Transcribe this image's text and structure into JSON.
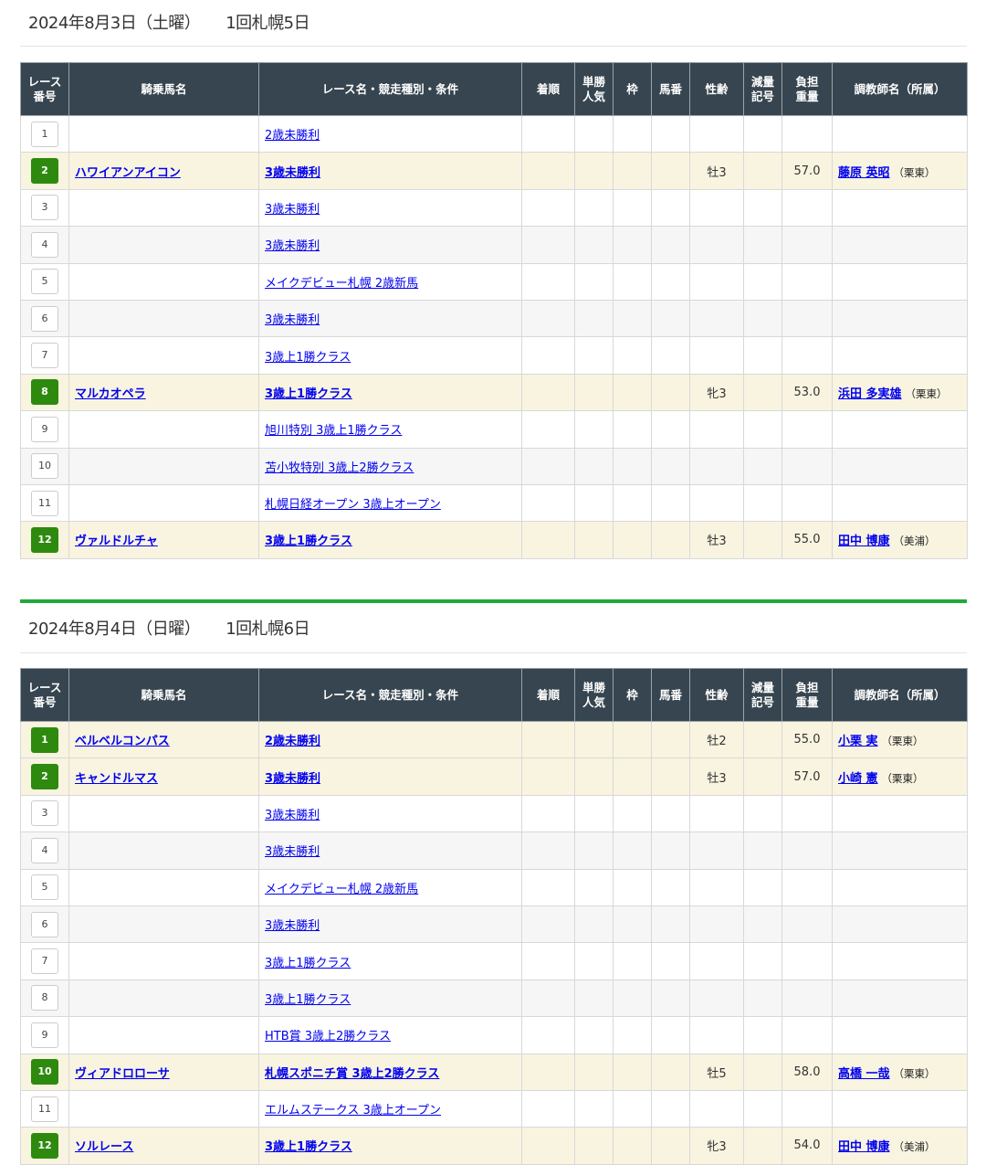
{
  "headers": [
    "レース\n番号",
    "騎乗馬名",
    "レース名・競走種別・条件",
    "着順",
    "単勝\n人気",
    "枠",
    "馬番",
    "性齢",
    "減量\n記号",
    "負担\n重量",
    "調教師名（所属）"
  ],
  "days": [
    {
      "date": "2024年8月3日（土曜）",
      "meeting": "1回札幌5日",
      "rows": [
        {
          "num": "1",
          "horse": "",
          "race": "2歳未勝利",
          "sex": "",
          "weight": "",
          "trainer": "",
          "affil": ""
        },
        {
          "num": "2",
          "horse": "ハワイアンアイコン",
          "race": "3歳未勝利",
          "sex": "牡3",
          "weight": "57.0",
          "trainer": "藤原 英昭",
          "affil": "（栗東）"
        },
        {
          "num": "3",
          "horse": "",
          "race": "3歳未勝利",
          "sex": "",
          "weight": "",
          "trainer": "",
          "affil": ""
        },
        {
          "num": "4",
          "horse": "",
          "race": "3歳未勝利",
          "sex": "",
          "weight": "",
          "trainer": "",
          "affil": ""
        },
        {
          "num": "5",
          "horse": "",
          "race": "メイクデビュー札幌 2歳新馬",
          "sex": "",
          "weight": "",
          "trainer": "",
          "affil": ""
        },
        {
          "num": "6",
          "horse": "",
          "race": "3歳未勝利",
          "sex": "",
          "weight": "",
          "trainer": "",
          "affil": ""
        },
        {
          "num": "7",
          "horse": "",
          "race": "3歳上1勝クラス",
          "sex": "",
          "weight": "",
          "trainer": "",
          "affil": ""
        },
        {
          "num": "8",
          "horse": "マルカオペラ",
          "race": "3歳上1勝クラス",
          "sex": "牝3",
          "weight": "53.0",
          "trainer": "浜田 多実雄",
          "affil": "（栗東）"
        },
        {
          "num": "9",
          "horse": "",
          "race": "旭川特別 3歳上1勝クラス",
          "sex": "",
          "weight": "",
          "trainer": "",
          "affil": ""
        },
        {
          "num": "10",
          "horse": "",
          "race": "苫小牧特別 3歳上2勝クラス",
          "sex": "",
          "weight": "",
          "trainer": "",
          "affil": ""
        },
        {
          "num": "11",
          "horse": "",
          "race": "札幌日経オープン 3歳上オープン",
          "sex": "",
          "weight": "",
          "trainer": "",
          "affil": ""
        },
        {
          "num": "12",
          "horse": "ヴァルドルチャ",
          "race": "3歳上1勝クラス",
          "sex": "牡3",
          "weight": "55.0",
          "trainer": "田中 博康",
          "affil": "（美浦）"
        }
      ]
    },
    {
      "date": "2024年8月4日（日曜）",
      "meeting": "1回札幌6日",
      "rows": [
        {
          "num": "1",
          "horse": "ベルベルコンパス",
          "race": "2歳未勝利",
          "sex": "牡2",
          "weight": "55.0",
          "trainer": "小栗 実",
          "affil": "（栗東）"
        },
        {
          "num": "2",
          "horse": "キャンドルマス",
          "race": "3歳未勝利",
          "sex": "牡3",
          "weight": "57.0",
          "trainer": "小崎 憲",
          "affil": "（栗東）"
        },
        {
          "num": "3",
          "horse": "",
          "race": "3歳未勝利",
          "sex": "",
          "weight": "",
          "trainer": "",
          "affil": ""
        },
        {
          "num": "4",
          "horse": "",
          "race": "3歳未勝利",
          "sex": "",
          "weight": "",
          "trainer": "",
          "affil": ""
        },
        {
          "num": "5",
          "horse": "",
          "race": "メイクデビュー札幌 2歳新馬",
          "sex": "",
          "weight": "",
          "trainer": "",
          "affil": ""
        },
        {
          "num": "6",
          "horse": "",
          "race": "3歳未勝利",
          "sex": "",
          "weight": "",
          "trainer": "",
          "affil": ""
        },
        {
          "num": "7",
          "horse": "",
          "race": "3歳上1勝クラス",
          "sex": "",
          "weight": "",
          "trainer": "",
          "affil": ""
        },
        {
          "num": "8",
          "horse": "",
          "race": "3歳上1勝クラス",
          "sex": "",
          "weight": "",
          "trainer": "",
          "affil": ""
        },
        {
          "num": "9",
          "horse": "",
          "race": "HTB賞 3歳上2勝クラス",
          "sex": "",
          "weight": "",
          "trainer": "",
          "affil": ""
        },
        {
          "num": "10",
          "horse": "ヴィアドロローサ",
          "race": "札幌スポニチ賞 3歳上2勝クラス",
          "sex": "牡5",
          "weight": "58.0",
          "trainer": "高橋 一哉",
          "affil": "（栗東）"
        },
        {
          "num": "11",
          "horse": "",
          "race": "エルムステークス 3歳上オープン",
          "sex": "",
          "weight": "",
          "trainer": "",
          "affil": ""
        },
        {
          "num": "12",
          "horse": "ソルレース",
          "race": "3歳上1勝クラス",
          "sex": "牝3",
          "weight": "54.0",
          "trainer": "田中 博康",
          "affil": "（美浦）"
        }
      ]
    }
  ]
}
